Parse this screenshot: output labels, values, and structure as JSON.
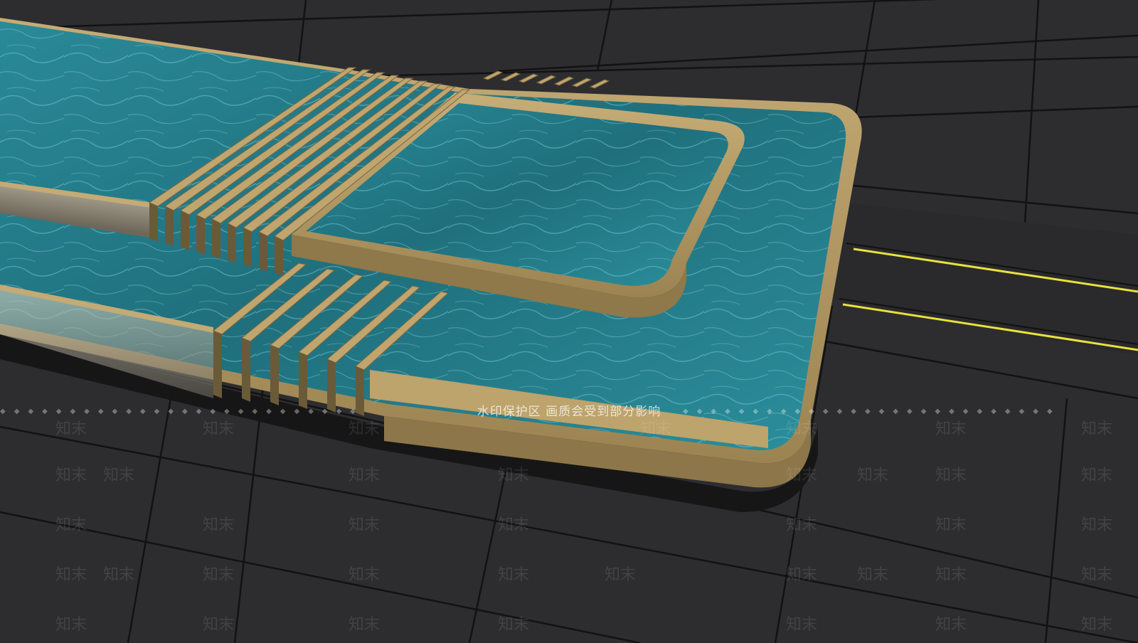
{
  "watermark": {
    "banner": "水印保护区  画质会受到部分影响",
    "brand": "知末"
  },
  "colors": {
    "paving": "#2d2d30",
    "paving_joint": "#121213",
    "water_deep": "#1f6f7c",
    "water_light": "#5fb4c0",
    "coping_gold": "#b39a66",
    "coping_dark": "#8a7448",
    "gravel": "#1a1a1b",
    "lane_line": "#e8e23a",
    "road": "#303033"
  }
}
